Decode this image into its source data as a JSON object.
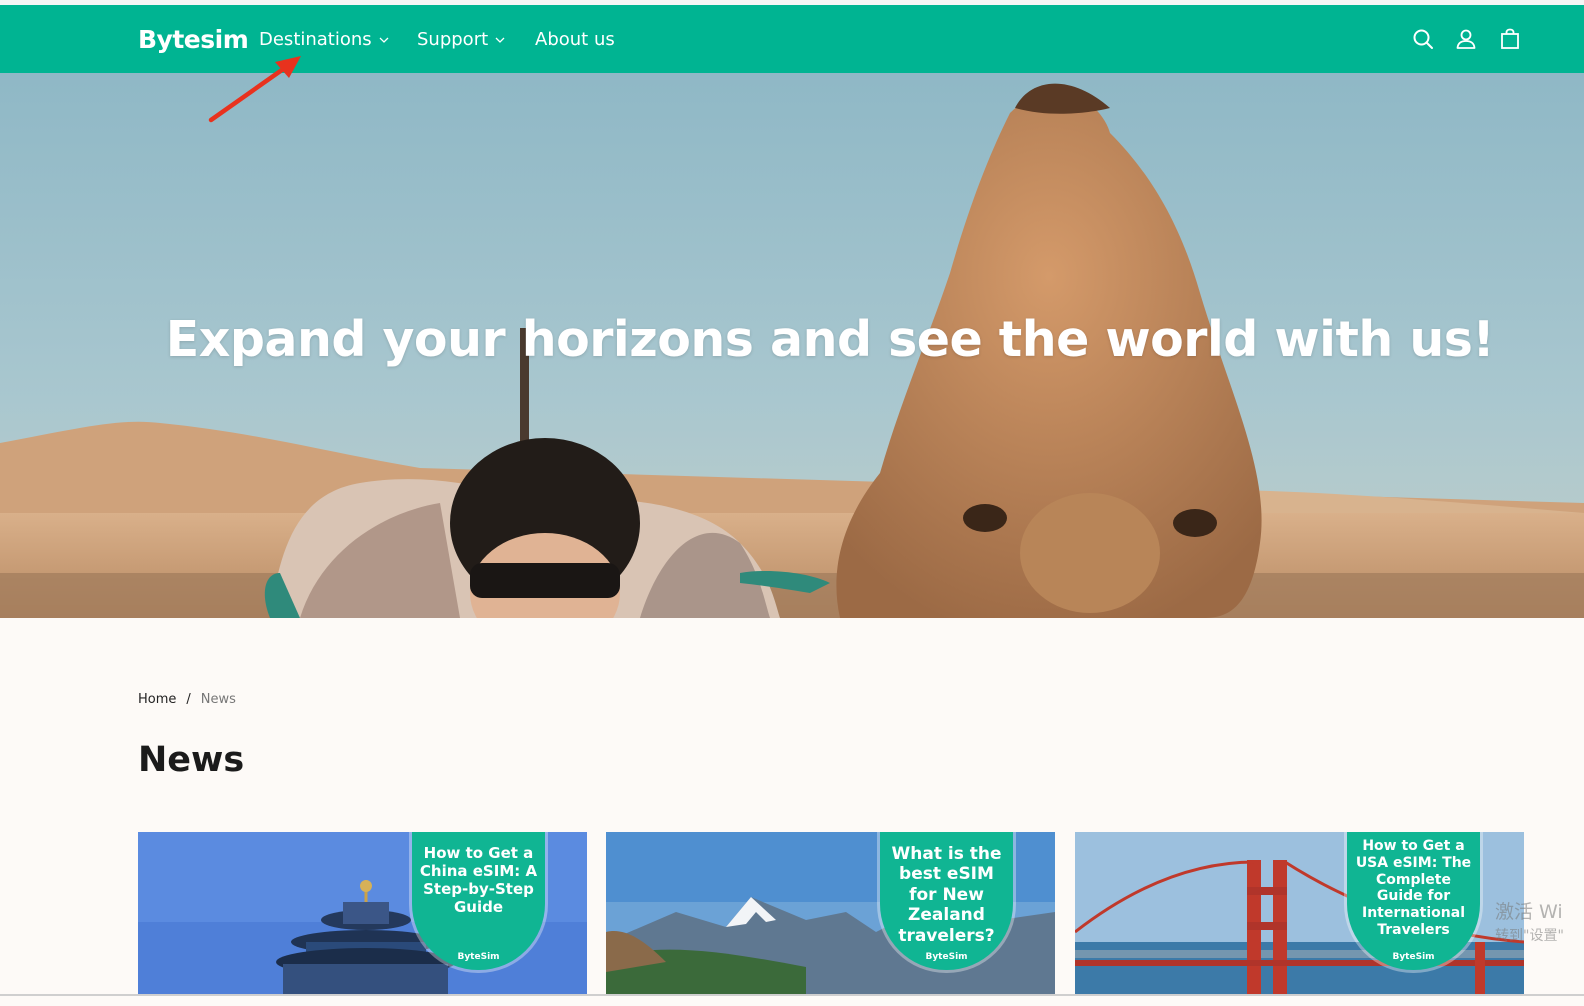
{
  "brand": {
    "logo": "Bytesim",
    "accent_color": "#00b492"
  },
  "nav": {
    "items": [
      {
        "label": "Destinations",
        "has_dropdown": true
      },
      {
        "label": "Support",
        "has_dropdown": true
      },
      {
        "label": "About us",
        "has_dropdown": false
      }
    ],
    "icons": [
      "search-icon",
      "account-icon",
      "cart-icon"
    ]
  },
  "hero": {
    "title": "Expand your horizons and see the world with us!"
  },
  "breadcrumb": {
    "home": "Home",
    "separator": "/",
    "current": "News"
  },
  "page": {
    "title": "News"
  },
  "cards": [
    {
      "badge": "How to Get a China eSIM: A Step-by-Step Guide",
      "brand": "ByteSim"
    },
    {
      "badge": "What is the best eSIM for New Zealand travelers?",
      "brand": "ByteSim"
    },
    {
      "badge": "How to Get a USA eSIM: The Complete Guide for International Travelers",
      "brand": "ByteSim"
    }
  ],
  "watermark": {
    "line1": "激活 Wi",
    "line2": "转到\"设置\""
  }
}
